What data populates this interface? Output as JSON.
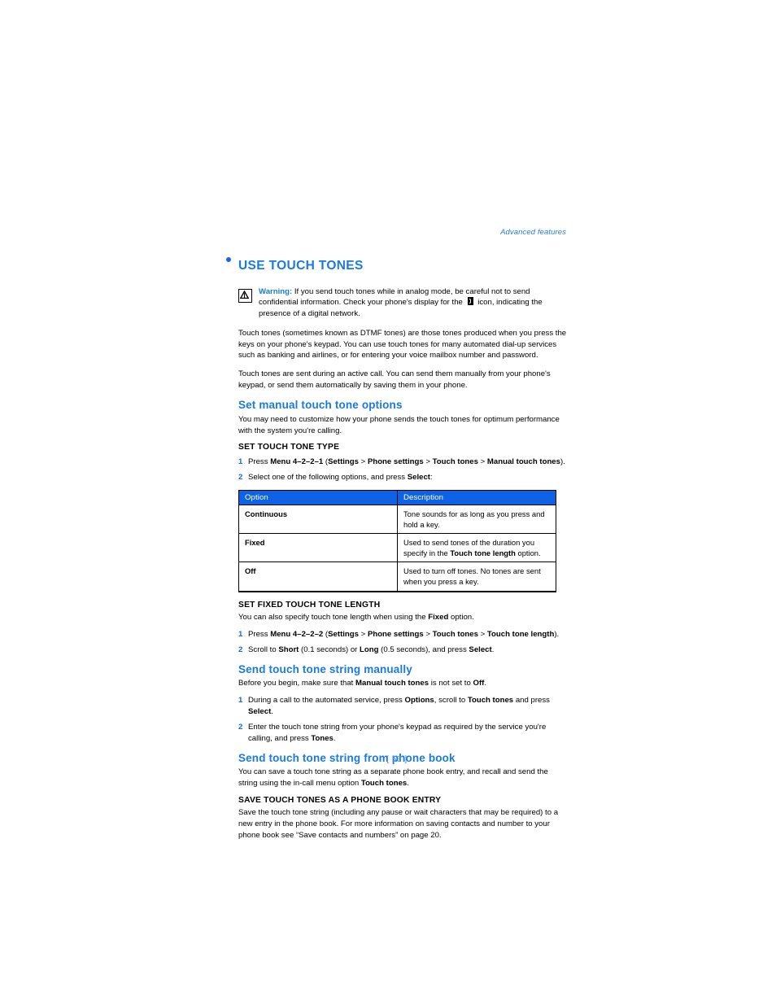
{
  "document": {
    "running_head": "Advanced features",
    "page_number": "[ 53 ]",
    "accent_blue": "#1a7ae0",
    "table_header_blue": "#0f62e6",
    "bullet_blue": "#1a66e0"
  },
  "chapter": {
    "bullet_icon": "bullet-dot-icon",
    "title": "USE TOUCH TONES"
  },
  "warning": {
    "icon": "warning-triangle-icon",
    "label": "Warning:",
    "text_part1": "If you send touch tones while in analog mode, be careful not to send confidential information. Check your phone's display for the",
    "inline_icon": "digital-network-icon",
    "text_part2": "icon, indicating the presence of a digital network."
  },
  "intro": {
    "paragraph1": "Touch tones (sometimes known as DTMF tones) are those tones produced when you press the keys on your phone's keypad. You can use touch tones for many automated dial-up services such as banking and airlines, or for entering your voice mailbox number and password.",
    "paragraph2": "Touch tones are sent during an active call. You can send them manually from your phone's keypad, or send them automatically by saving them in your phone."
  },
  "section_manual_options": {
    "heading": "Set manual touch tone options",
    "intro": "You may need to customize how your phone sends the touch tones for optimum performance with the system you're calling.",
    "sub_heading": "SET TOUCH TONE TYPE",
    "steps": [
      {
        "num": "1",
        "pre": "Press ",
        "bold1": "Menu 4–2–2–1",
        "mid1": " (",
        "bold2": "Settings",
        "mid2": " > ",
        "bold3": "Phone settings",
        "mid3": " > ",
        "bold4": "Touch tones",
        "mid4": " > ",
        "bold5": "Manual touch tones",
        "post": ")."
      },
      {
        "num": "2",
        "pre": "Select one of the following options, and press ",
        "bold1": "Select",
        "post": ":"
      }
    ],
    "table": {
      "columns": [
        "Option",
        "Description"
      ],
      "rows": [
        {
          "option": "Continuous",
          "description_pre": "Tone sounds for as long as you press and hold a key.",
          "description_bold": "",
          "description_post": ""
        },
        {
          "option": "Fixed",
          "description_pre": "Used to send tones of the duration you specify in the ",
          "description_bold": "Touch tone length",
          "description_post": " option."
        },
        {
          "option": "Off",
          "description_pre": "Used to turn off tones. No tones are sent when you press a key.",
          "description_bold": "",
          "description_post": ""
        }
      ]
    }
  },
  "section_fixed_length": {
    "sub_heading": "SET FIXED TOUCH TONE LENGTH",
    "intro_pre": "You can also specify touch tone length when using the ",
    "intro_bold": "Fixed",
    "intro_post": " option.",
    "steps": [
      {
        "num": "1",
        "pre": "Press ",
        "bold1": "Menu 4–2–2–2",
        "mid1": " (",
        "bold2": "Settings",
        "mid2": " > ",
        "bold3": "Phone settings",
        "mid3": " > ",
        "bold4": "Touch tones",
        "mid4": " > ",
        "bold5": "Touch tone length",
        "post": ")."
      },
      {
        "num": "2",
        "pre": "Scroll to ",
        "bold1": "Short",
        "mid1": " (0.1 seconds) or ",
        "bold2": "Long",
        "mid2": " (0.5 seconds), and press ",
        "bold3": "Select",
        "post": "."
      }
    ]
  },
  "section_send_manually": {
    "heading": "Send touch tone string manually",
    "intro_pre": "Before you begin, make sure that ",
    "intro_bold1": "Manual touch tones",
    "intro_mid": " is not set to ",
    "intro_bold2": "Off",
    "intro_post": ".",
    "steps": [
      {
        "num": "1",
        "pre": "During a call to the automated service, press ",
        "bold1": "Options",
        "mid1": ", scroll to ",
        "bold2": "Touch tones",
        "mid2": " and press ",
        "bold3": "Select",
        "post": "."
      },
      {
        "num": "2",
        "pre": "Enter the touch tone string from your phone's keypad as required by the service you're calling, and press ",
        "bold1": "Tones",
        "post": "."
      }
    ]
  },
  "section_phone_book": {
    "heading": "Send touch tone string from phone book",
    "intro_pre": "You can save a touch tone string as a separate phone book entry, and recall and send the string using the in-call menu option ",
    "intro_bold": "Touch tones",
    "intro_post": ".",
    "sub_heading": "SAVE TOUCH TONES AS A PHONE BOOK ENTRY",
    "body": "Save the touch tone string (including any pause or wait characters that may be required) to a new entry in the phone book. For more information on saving contacts and number to your phone book see “Save contacts and numbers” on page 20."
  }
}
